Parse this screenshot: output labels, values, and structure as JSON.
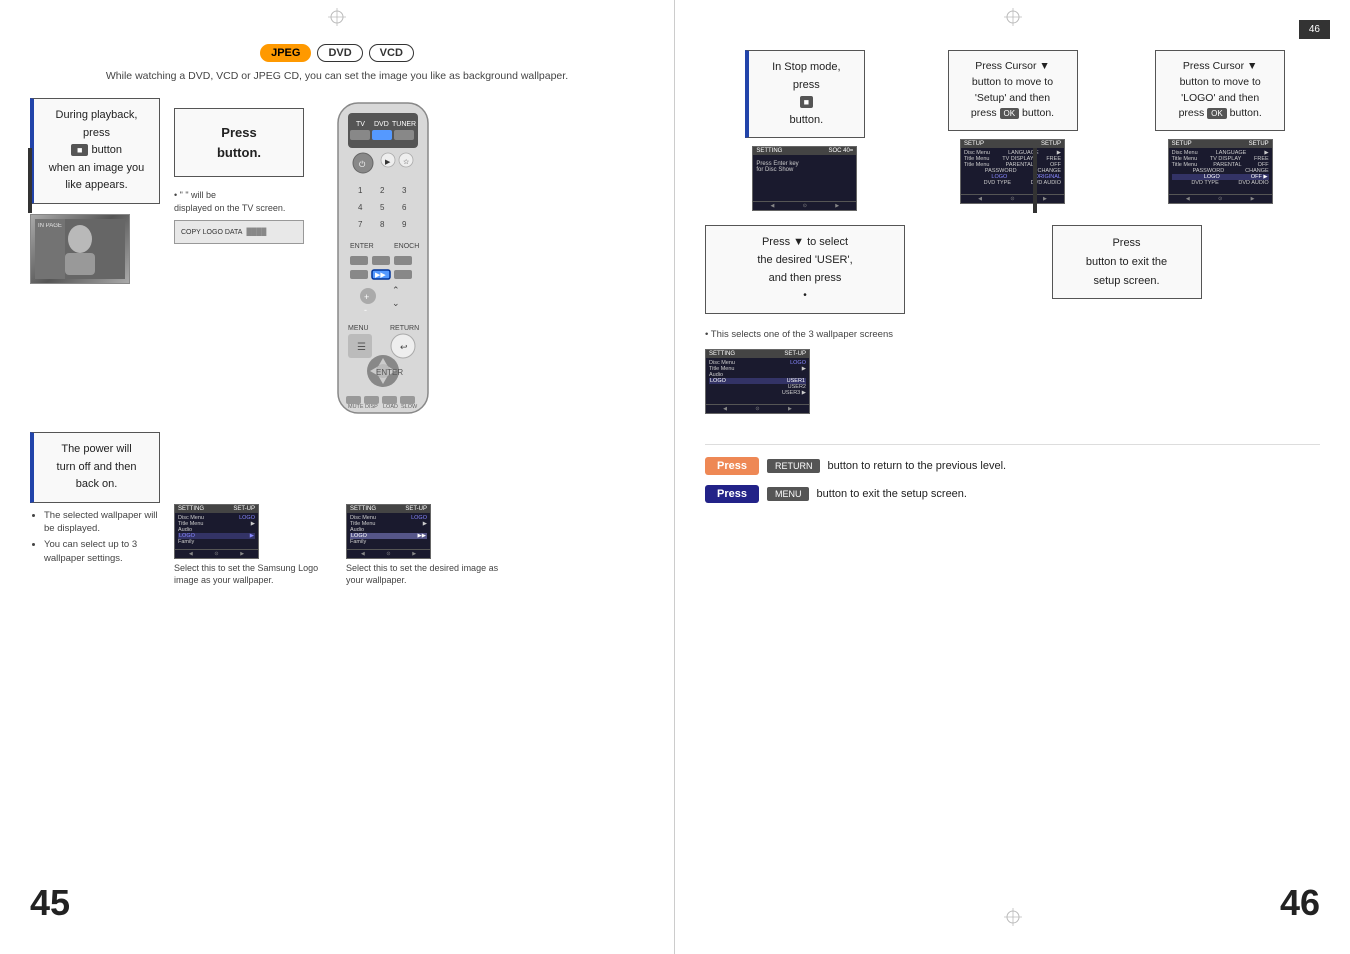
{
  "left_page": {
    "number": "45",
    "header": {
      "badges": [
        "JPEG",
        "DVD",
        "VCD"
      ],
      "description": "While watching a DVD, VCD or JPEG CD, you can set the image you like as background wallpaper."
    },
    "step1": {
      "text": "During playback, press\nbutton\nwhen an image you\nlike appears.",
      "note": "• \" \" will be\ndisplayed on the TV screen."
    },
    "step1_button": "Press\nbutton.",
    "step2_title": "The power will\nturn off and then\nback on.",
    "step2_bullets": [
      "The selected wallpaper will be displayed.",
      "You can select up to 3 wallpaper settings."
    ],
    "thumb1_caption": "Select this to set the Samsung Logo image as your wallpaper.",
    "thumb2_caption": "Select this to set the desired image as your wallpaper."
  },
  "right_page": {
    "number": "46",
    "dark_tab": "46",
    "col1": {
      "step1_text": "In Stop mode,\npress\nbutton.",
      "step2_text": "Press ▼ to select\nthe desired 'USER',\nand then press\n.",
      "step2_note": "• This selects one of the 3 wallpaper screens"
    },
    "col2": {
      "step1_text": "Press Cursor ▼\nbutton to move to\n'Setup' and then\npress      button.",
      "step2_text": "Press\nbutton to exit the\nsetup screen."
    },
    "col3": {
      "step1_text": "Press Cursor ▼\nbutton to move to\n'LOGO' and then\npress      button."
    },
    "press1": "Press",
    "press1_suffix": "button to return to the previous level.",
    "press2": "Press",
    "press2_suffix": "button to exit the setup screen.",
    "screens": {
      "s1_title": "SETTING",
      "s1_right": "SETUP",
      "s2_title": "SETUP",
      "s3_title": "SETUP"
    }
  }
}
